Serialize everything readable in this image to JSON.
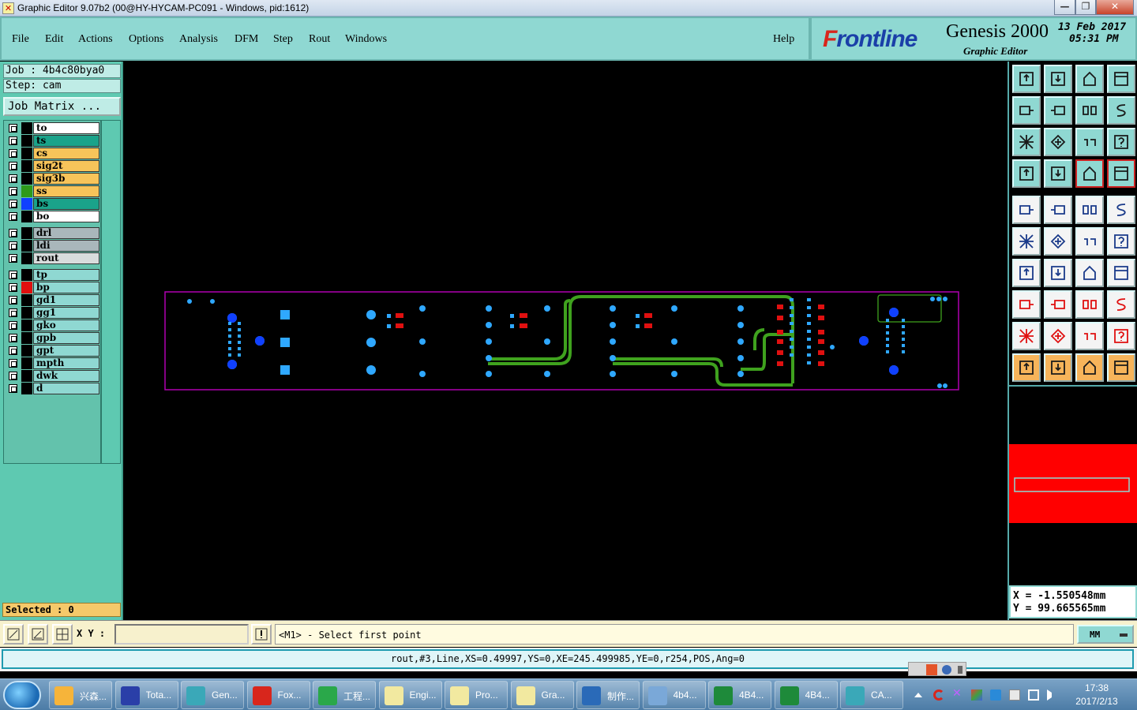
{
  "window": {
    "title": "Graphic Editor 9.07b2 (00@HY-HYCAM-PC091 - Windows, pid:1612)",
    "minimize": "—",
    "maximize": "❐",
    "close": "✕"
  },
  "menu": {
    "items": [
      "File",
      "Edit",
      "Actions",
      "Options",
      "Analysis",
      "DFM",
      "Step",
      "Rout",
      "Windows"
    ],
    "help": "Help"
  },
  "brand": {
    "logo_prefix": "F",
    "logo_rest": "rontline",
    "product": "Genesis 2000",
    "subtitle": "Graphic Editor",
    "date": "13 Feb 2017",
    "time": "05:31 PM"
  },
  "job": {
    "job_label": "Job : 4b4c80bya0",
    "step_label": "Step: cam",
    "matrix_button": "Job Matrix ..."
  },
  "layers": [
    {
      "name": "to",
      "swatch": "#000000",
      "bg": "#ffffff"
    },
    {
      "name": "ts",
      "swatch": "#000000",
      "bg": "#1aa38a"
    },
    {
      "name": "cs",
      "swatch": "#000000",
      "bg": "#f7c45a"
    },
    {
      "name": "sig2t",
      "swatch": "#000000",
      "bg": "#f7c45a"
    },
    {
      "name": "sig3b",
      "swatch": "#000000",
      "bg": "#f7c45a"
    },
    {
      "name": "ss",
      "swatch": "#2e9a1a",
      "bg": "#f7c45a"
    },
    {
      "name": "bs",
      "swatch": "#1040ff",
      "bg": "#1aa38a"
    },
    {
      "name": "bo",
      "swatch": "#000000",
      "bg": "#ffffff"
    },
    {
      "name": "drl",
      "swatch": "#000000",
      "bg": "#a9b7bb"
    },
    {
      "name": "ldi",
      "swatch": "#000000",
      "bg": "#a9b7bb"
    },
    {
      "name": "rout",
      "swatch": "#000000",
      "bg": "#d8dcdc"
    },
    {
      "name": "tp",
      "swatch": "#000000",
      "bg": "#8fd8d2"
    },
    {
      "name": "bp",
      "swatch": "#e01010",
      "bg": "#8fd8d2"
    },
    {
      "name": "gd1",
      "swatch": "#000000",
      "bg": "#8fd8d2"
    },
    {
      "name": "gg1",
      "swatch": "#000000",
      "bg": "#8fd8d2"
    },
    {
      "name": "gko",
      "swatch": "#000000",
      "bg": "#8fd8d2"
    },
    {
      "name": "gpb",
      "swatch": "#000000",
      "bg": "#8fd8d2"
    },
    {
      "name": "gpt",
      "swatch": "#000000",
      "bg": "#8fd8d2"
    },
    {
      "name": "mpth",
      "swatch": "#000000",
      "bg": "#8fd8d2"
    },
    {
      "name": "dwk",
      "swatch": "#000000",
      "bg": "#8fd8d2"
    },
    {
      "name": "d",
      "swatch": "#000000",
      "bg": "#8fd8d2"
    }
  ],
  "selected_label": "Selected : 0",
  "coords": {
    "x": "X = -1.550548mm",
    "y": "Y = 99.665565mm"
  },
  "command": {
    "xy_label": "X Y :",
    "xy_value": "",
    "prompt": "<M1> - Select first point",
    "units": "MM"
  },
  "status_line": "rout,#3,Line,XS=0.49997,YS=0,XE=245.499985,YE=0,r254,POS,Ang=0",
  "toolbar_icons": [
    "snap-top-icon",
    "snap-bottom-icon",
    "home-icon",
    "window-icon",
    "pan-left-icon",
    "pan-right-icon",
    "flip-icon",
    "redraw-icon",
    "fit-icon",
    "zoom-icon",
    "scale-icon",
    "help-icon",
    "measure-icon",
    "feature-icon",
    "graphic-control-icon",
    "display-control-icon",
    "pad-icon",
    "polygon-icon",
    "ruler-icon",
    "circle-icon",
    "snap-icon",
    "cross-icon",
    "line-icon",
    "arc-icon",
    "angle-icon",
    "slope-icon",
    "curve-icon",
    "mirror-icon",
    "move-icon",
    "delete-icon",
    "center-icon",
    "group-icon",
    "triangle-icon",
    "peak-icon",
    "arrow-up-icon",
    "transform-icon",
    "pointer-icon",
    "select-icon",
    "pick-icon",
    "net-icon"
  ],
  "taskbar": {
    "tasks": [
      {
        "label": "兴森...",
        "color": "#f6b43a"
      },
      {
        "label": "Tota...",
        "color": "#2a3fa8"
      },
      {
        "label": "Gen...",
        "color": "#3aa8b8"
      },
      {
        "label": "Fox...",
        "color": "#d8261c"
      },
      {
        "label": "工程...",
        "color": "#2aa84a"
      },
      {
        "label": "Engi...",
        "color": "#f2e9a0"
      },
      {
        "label": "Pro...",
        "color": "#f2e9a0"
      },
      {
        "label": "Gra...",
        "color": "#f2e9a0"
      },
      {
        "label": "制作...",
        "color": "#2a6ab8"
      },
      {
        "label": "4b4...",
        "color": "#7aa8d8"
      },
      {
        "label": "4B4...",
        "color": "#1e8a3a"
      },
      {
        "label": "4B4...",
        "color": "#1e8a3a"
      },
      {
        "label": "CA...",
        "color": "#3aa8b8"
      }
    ],
    "clock_time": "17:38",
    "clock_date": "2017/2/13"
  },
  "colors": {
    "panel": "#8fd8d2",
    "layer_panel": "#5ec9b1",
    "trace": "#3fa21e",
    "pad_blue": "#2fa8ff",
    "pad_red": "#e01010",
    "outline": "#b000b0"
  }
}
